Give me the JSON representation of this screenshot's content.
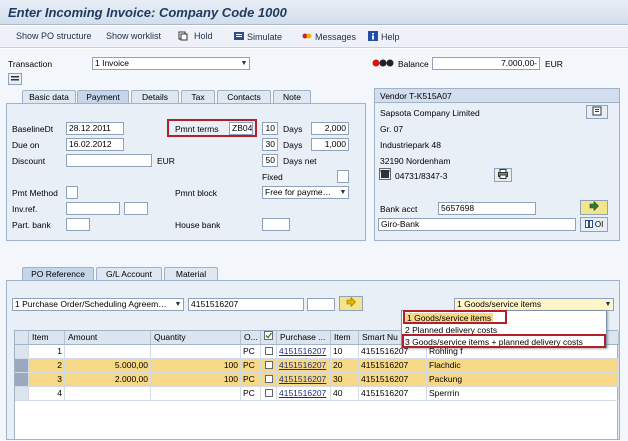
{
  "window": {
    "title": "Enter Incoming Invoice: Company Code 1000"
  },
  "toolbar": {
    "show_po_structure": "Show PO structure",
    "show_worklist": "Show worklist",
    "hold": "Hold",
    "simulate": "Simulate",
    "messages": "Messages",
    "help": "Help"
  },
  "header": {
    "transaction_label": "Transaction",
    "transaction_value": "1 Invoice",
    "balance_label": "Balance",
    "balance_value": "7.000,00-",
    "balance_currency": "EUR"
  },
  "tabs_top": [
    "Basic data",
    "Payment",
    "Details",
    "Tax",
    "Contacts",
    "Note"
  ],
  "payment": {
    "baseline_label": "BaselineDt",
    "baseline_value": "28.12.2011",
    "pmnt_terms_label": "Pmnt terms",
    "pmnt_terms_value": "ZB04",
    "due_on_label": "Due on",
    "due_on_value": "16.02.2012",
    "discount_label": "Discount",
    "discount_currency": "EUR",
    "days1": "10",
    "pct1": "2,000",
    "days2": "30",
    "pct2": "1,000",
    "days3": "50",
    "days_label": "Days",
    "days_net_label": "Days net",
    "fixed_label": "Fixed",
    "pmt_method_label": "Pmt Method",
    "pmnt_block_label": "Pmnt block",
    "pmnt_block_value": "Free for payme…",
    "invref_label": "Inv.ref.",
    "part_bank_label": "Part. bank",
    "house_bank_label": "House bank"
  },
  "vendor": {
    "title": "Vendor T-K515A07",
    "name": "Sapsota Company Limited",
    "line2": "Gr. 07",
    "street": "Industriepark 48",
    "city": "32190 Nordenham",
    "phone": "04731/8347-3",
    "bank_acct_label": "Bank acct",
    "bank_acct_value": "5657698",
    "bank_name": "Giro-Bank",
    "oi_label": "OI"
  },
  "tabs_bottom": [
    "PO Reference",
    "G/L Account",
    "Material"
  ],
  "po_ref": {
    "ref_type": "1 Purchase Order/Scheduling Agreem…",
    "po_number": "4151516207",
    "layout_value": "1 Goods/service items",
    "options": [
      "1 Goods/service items",
      "2 Planned delivery costs",
      "3 Goods/service items + planned delivery costs"
    ]
  },
  "table": {
    "headers": [
      "Item",
      "Amount",
      "Quantity",
      "O...",
      "Purchase ...",
      "Item",
      "Smart Nu"
    ],
    "rows": [
      {
        "item": "1",
        "amount": "",
        "qty": "",
        "unit": "PC",
        "po": "4151516207",
        "po_item": "10",
        "smart": "4151516207",
        "text": "Rohling f",
        "hl": false
      },
      {
        "item": "2",
        "amount": "5.000,00",
        "qty": "100",
        "unit": "PC",
        "po": "4151516207",
        "po_item": "20",
        "smart": "4151516207",
        "text": "Flachdic",
        "hl": true
      },
      {
        "item": "3",
        "amount": "2.000,00",
        "qty": "100",
        "unit": "PC",
        "po": "4151516207",
        "po_item": "30",
        "smart": "4151516207",
        "text": "Packung",
        "hl": true
      },
      {
        "item": "4",
        "amount": "",
        "qty": "",
        "unit": "PC",
        "po": "4151516207",
        "po_item": "40",
        "smart": "4151516207",
        "text": "Sperrrin",
        "hl": false
      }
    ]
  },
  "colors": {
    "highlight": "#f7d886",
    "red_frame": "#b21f2d",
    "title_text": "#1e3a5f"
  }
}
